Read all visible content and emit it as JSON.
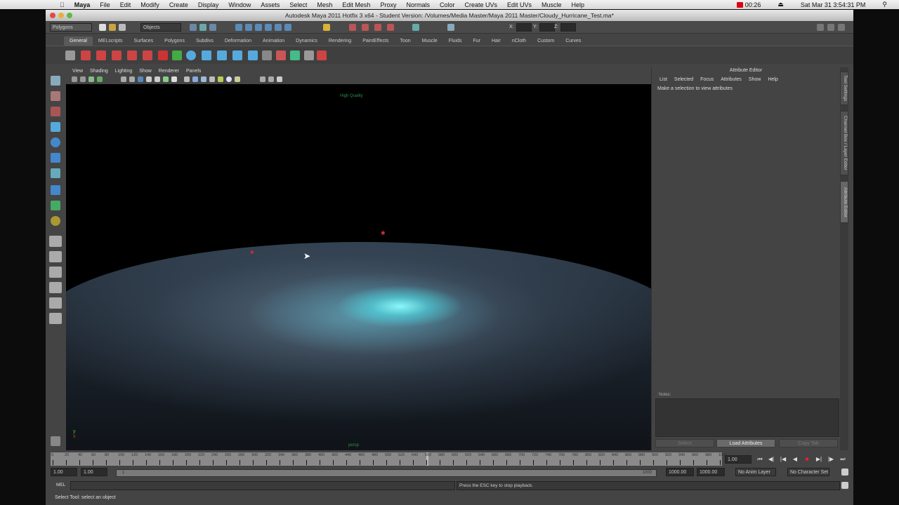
{
  "menubar": {
    "app": "Maya",
    "items": [
      "File",
      "Edit",
      "Modify",
      "Create",
      "Display",
      "Window",
      "Assets",
      "Select",
      "Mesh",
      "Edit Mesh",
      "Proxy",
      "Normals",
      "Color",
      "Create UVs",
      "Edit UVs",
      "Muscle",
      "Help"
    ],
    "recording_time": "00:26",
    "datetime": "Sat Mar 31  3:54:31 PM"
  },
  "window": {
    "title": "Autodesk Maya 2011 Hotfix 3 x64 - Student Version: /Volumes/Media Master/Maya 2011 Master/Cloudy_Hurricane_Test.ma*"
  },
  "statusline": {
    "menuset": "Polygons",
    "selection_mask": "Objects",
    "x_label": "X:",
    "y_label": "Y:",
    "z_label": "Z:"
  },
  "shelf": {
    "tabs": [
      "General",
      "MELscripts",
      "Surfaces",
      "Polygons",
      "Subdivs",
      "Deformation",
      "Animation",
      "Dynamics",
      "Rendering",
      "PaintEffects",
      "Toon",
      "Muscle",
      "Fluids",
      "Fur",
      "Hair",
      "nCloth",
      "Custom",
      "Curves"
    ],
    "active": "General"
  },
  "panel": {
    "menu": [
      "View",
      "Shading",
      "Lighting",
      "Show",
      "Renderer",
      "Panels"
    ],
    "hud_top": "High Quality",
    "camera": "persp"
  },
  "attribute_editor": {
    "title": "Attribute Editor",
    "menu": [
      "List",
      "Selected",
      "Focus",
      "Attributes",
      "Show",
      "Help"
    ],
    "message": "Make a selection to view attributes",
    "notes_label": "Notes:",
    "buttons": [
      "Select",
      "Load Attributes",
      "Copy Tab"
    ]
  },
  "side_tabs": [
    "Tool Settings",
    "Channel Box / Layer Editor",
    "Attribute Editor"
  ],
  "timeline": {
    "start": 0,
    "end": 1000,
    "step": 20,
    "current_frame": "1.00",
    "current": 560
  },
  "range": {
    "start_time": "1.00",
    "playback_start": "1.00",
    "slider_marker": "1",
    "slider_end": "1000",
    "playback_end": "1000.00",
    "end_time": "1000.00",
    "anim_layer": "No Anim Layer",
    "character_set": "No Character Set"
  },
  "command_line": {
    "label": "MEL",
    "result": "Press the ESC key to stop playback."
  },
  "help_line": "Select Tool: select an object"
}
